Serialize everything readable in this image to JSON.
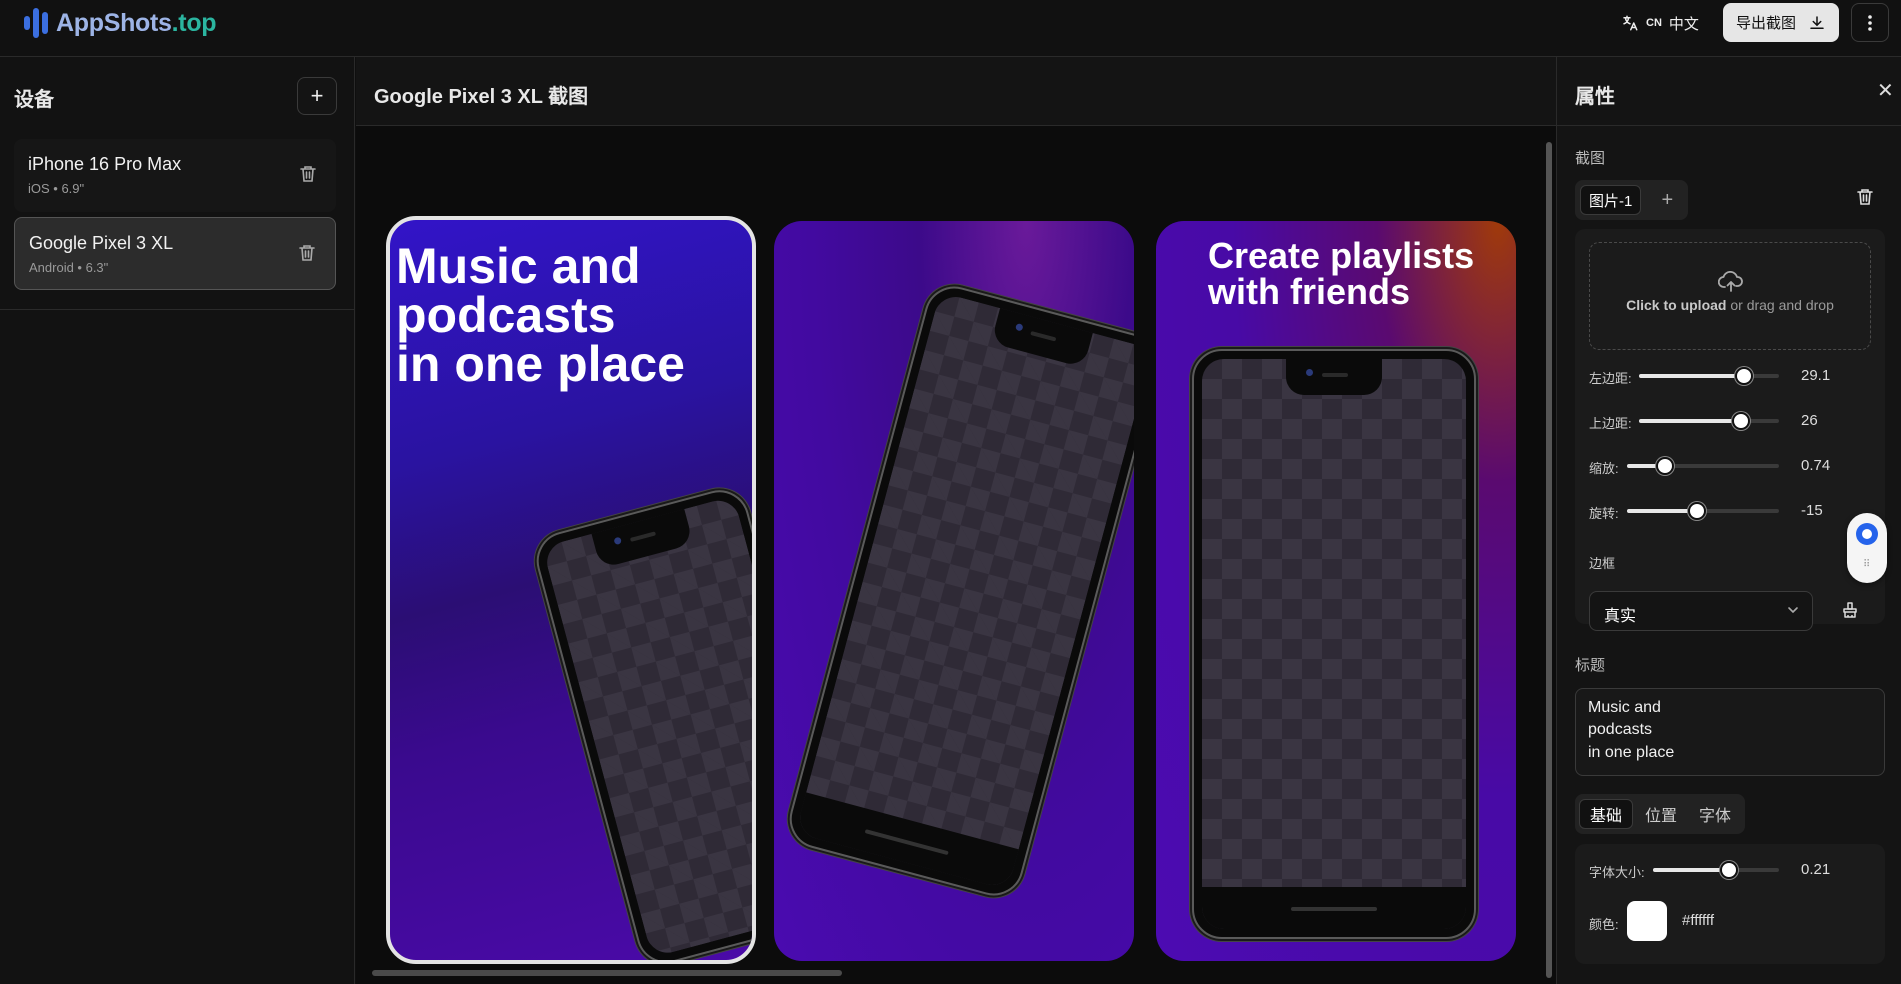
{
  "app": {
    "logo_brand": "AppShots",
    "logo_tld": ".top"
  },
  "topbar": {
    "lang_code": "CN",
    "lang_label": "中文",
    "export_label": "导出截图"
  },
  "sidebar": {
    "title": "设备",
    "devices": [
      {
        "name": "iPhone 16 Pro Max",
        "meta": "iOS • 6.9\"",
        "selected": false
      },
      {
        "name": "Google Pixel 3 XL",
        "meta": "Android • 6.3\"",
        "selected": true
      }
    ]
  },
  "center": {
    "title": "Google Pixel 3 XL 截图",
    "screenshots": [
      {
        "title": "Music and\npodcasts\nin one place",
        "rotation_deg": -15
      },
      {
        "title": "",
        "rotation_deg": 15
      },
      {
        "title": "Create playlists\nwith friends",
        "rotation_deg": 0
      }
    ]
  },
  "panel": {
    "title": "属性",
    "screenshot_section_label": "截图",
    "image_tab": "图片-1",
    "upload_strong": "Click to upload",
    "upload_rest": " or drag and drop",
    "sliders": [
      {
        "label": "左边距:",
        "value": "29.1",
        "fraction": 0.75
      },
      {
        "label": "上边距:",
        "value": "26",
        "fraction": 0.73
      },
      {
        "label": "缩放:",
        "value": "0.74",
        "fraction": 0.25
      },
      {
        "label": "旋转:",
        "value": "-15",
        "fraction": 0.46
      }
    ],
    "frame_label": "边框",
    "frame_value": "真实",
    "title_section_label": "标题",
    "title_text": "Music and\npodcasts\nin one place",
    "tabs": [
      "基础",
      "位置",
      "字体"
    ],
    "active_tab": "基础",
    "font_size_label": "字体大小:",
    "font_size_value": "0.21",
    "font_size_fraction": 0.6,
    "color_label": "颜色:",
    "color_value": "#ffffff"
  },
  "colors": {
    "accent_blue": "#3b6fe0",
    "brand_teal": "#2bb5a0",
    "background": "#0f0f0f"
  }
}
